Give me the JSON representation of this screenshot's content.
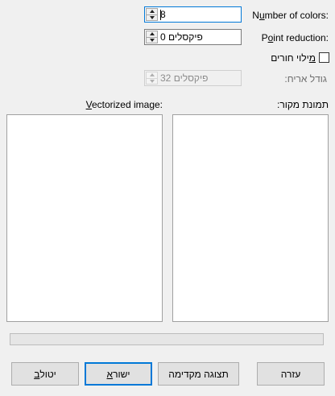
{
  "number_of_colors": {
    "label_pre": "N",
    "label_accel": "u",
    "label_post": "mber of colors:",
    "value": "8"
  },
  "point_reduction": {
    "label_pre": "P",
    "label_accel": "o",
    "label_post": "int reduction:",
    "value": "פיקסלים 0"
  },
  "fill_holes": {
    "label_accel": "מ",
    "label_post": "ילוי חורים",
    "checked": false
  },
  "tile_size": {
    "label": "גודל אריח:",
    "value": "פיקסלים 32",
    "enabled": false
  },
  "source_image": {
    "label": "תמונת מקור:"
  },
  "vectorized_image": {
    "label_accel": "V",
    "label_post": "ectorized image:"
  },
  "progress": {
    "value": 0
  },
  "buttons": {
    "help": "עזרה",
    "preview": "תצוגה מקדימה",
    "ok_accel": "א",
    "ok_post": "ישור",
    "cancel_accel": "ב",
    "cancel_post": "יטול"
  }
}
